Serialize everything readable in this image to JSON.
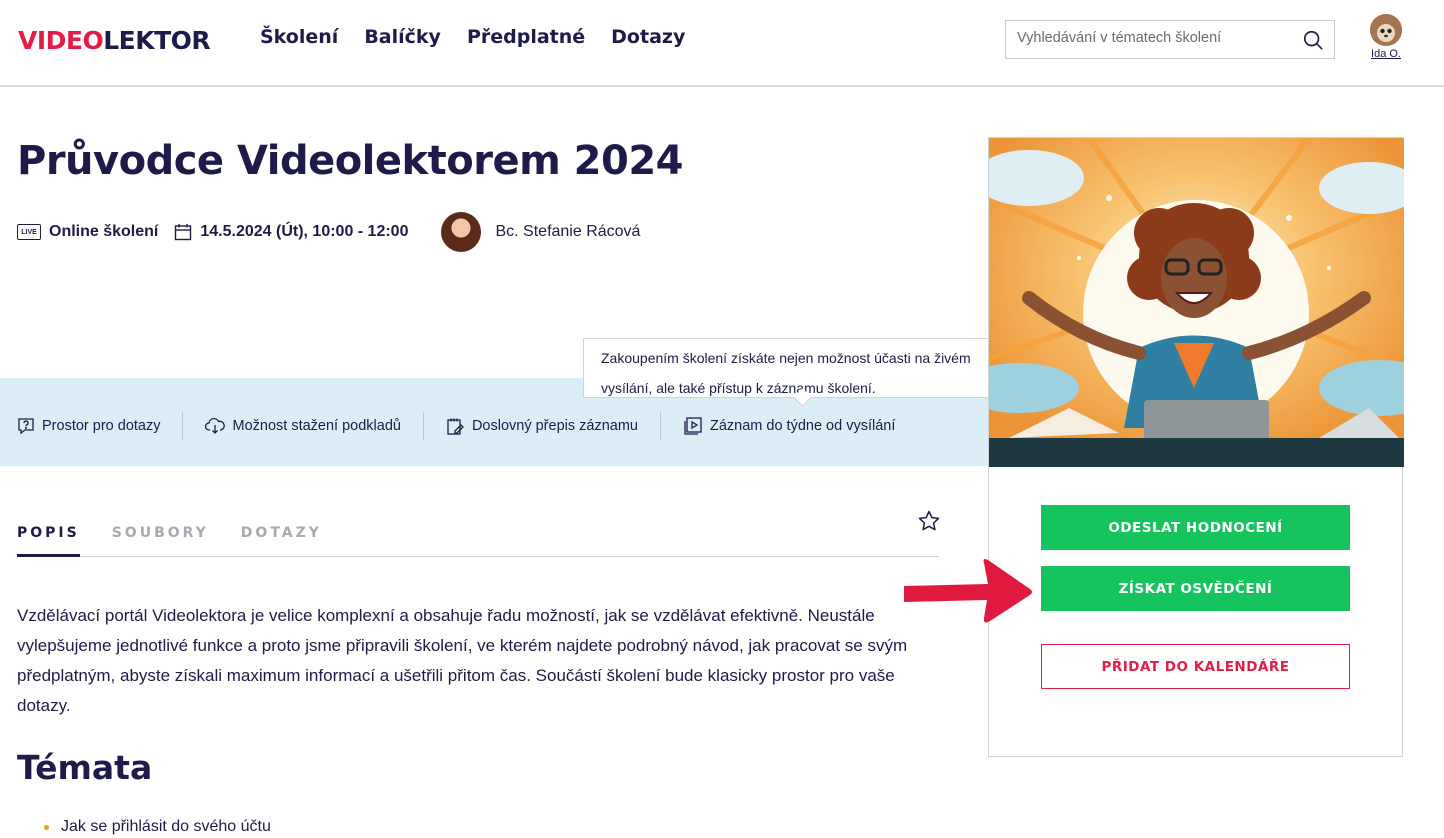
{
  "header": {
    "logo_part1": "VIDEO",
    "logo_part2": "LEKTOR",
    "nav": [
      "Školení",
      "Balíčky",
      "Předplatné",
      "Dotazy"
    ],
    "search_placeholder": "Vyhledávání v tématech školení",
    "user_name": "Ida O."
  },
  "course": {
    "title": "Průvodce Videolektorem 2024",
    "live_badge": "LIVE",
    "type": "Online školení",
    "datetime": "14.5.2024 (Út), 10:00 - 12:00",
    "lector": "Bc. Stefanie Rácová"
  },
  "features": [
    "Prostor pro dotazy",
    "Možnost stažení podkladů",
    "Doslovný přepis záznamu",
    "Záznam do týdne od vysílání"
  ],
  "tooltip": "Zakoupením školení získáte nejen možnost účasti na živém vysílání, ale také přístup k záznamu školení.",
  "tabs": [
    "POPIS",
    "SOUBORY",
    "DOTAZY"
  ],
  "description": "Vzdělávací portál Videolektora je velice komplexní a obsahuje řadu možností, jak se vzdělávat efektivně. Neustále vylepšujeme jednotlivé funkce a proto jsme připravili školení, ve kterém najdete podrobný návod, jak pracovat se svým předplatným, abyste získali maximum informací a ušetřili přitom čas. Součástí školení bude klasicky prostor pro vaše dotazy.",
  "topics_heading": "Témata",
  "topics": [
    "Jak se přihlásit do svého účtu"
  ],
  "actions": {
    "rate": "ODESLAT HODNOCENÍ",
    "certificate": "ZÍSKAT OSVĚDČENÍ",
    "calendar": "PŘIDAT DO KALENDÁŘE"
  },
  "colors": {
    "brand_red": "#e11d48",
    "navy": "#1e1b4b",
    "green": "#16c45e",
    "feature_bg": "#dbeef8"
  }
}
